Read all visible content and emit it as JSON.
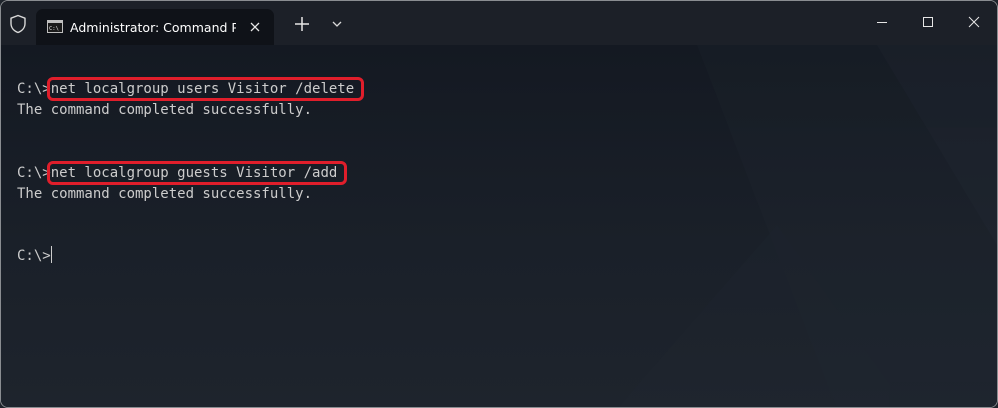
{
  "window": {
    "tab_title": "Administrator: Command Prompt"
  },
  "terminal": {
    "prompt": "C:\\>",
    "command_1": "net localgroup users Visitor /delete",
    "output_1": "The command completed successfully.",
    "command_2": "net localgroup guests Visitor /add",
    "output_2": "The command completed successfully."
  },
  "icons": {
    "shield": "shield-icon",
    "tab": "command-prompt-icon",
    "close_tab": "close-icon",
    "new_tab": "plus-icon",
    "dropdown": "chevron-down-icon",
    "minimize": "minimize-icon",
    "maximize": "maximize-icon",
    "close_window": "close-icon"
  },
  "colors": {
    "highlight": "#e01e2b",
    "text": "#cccccc",
    "titlebar": "#1c2028",
    "terminal_bg": "#141922"
  }
}
